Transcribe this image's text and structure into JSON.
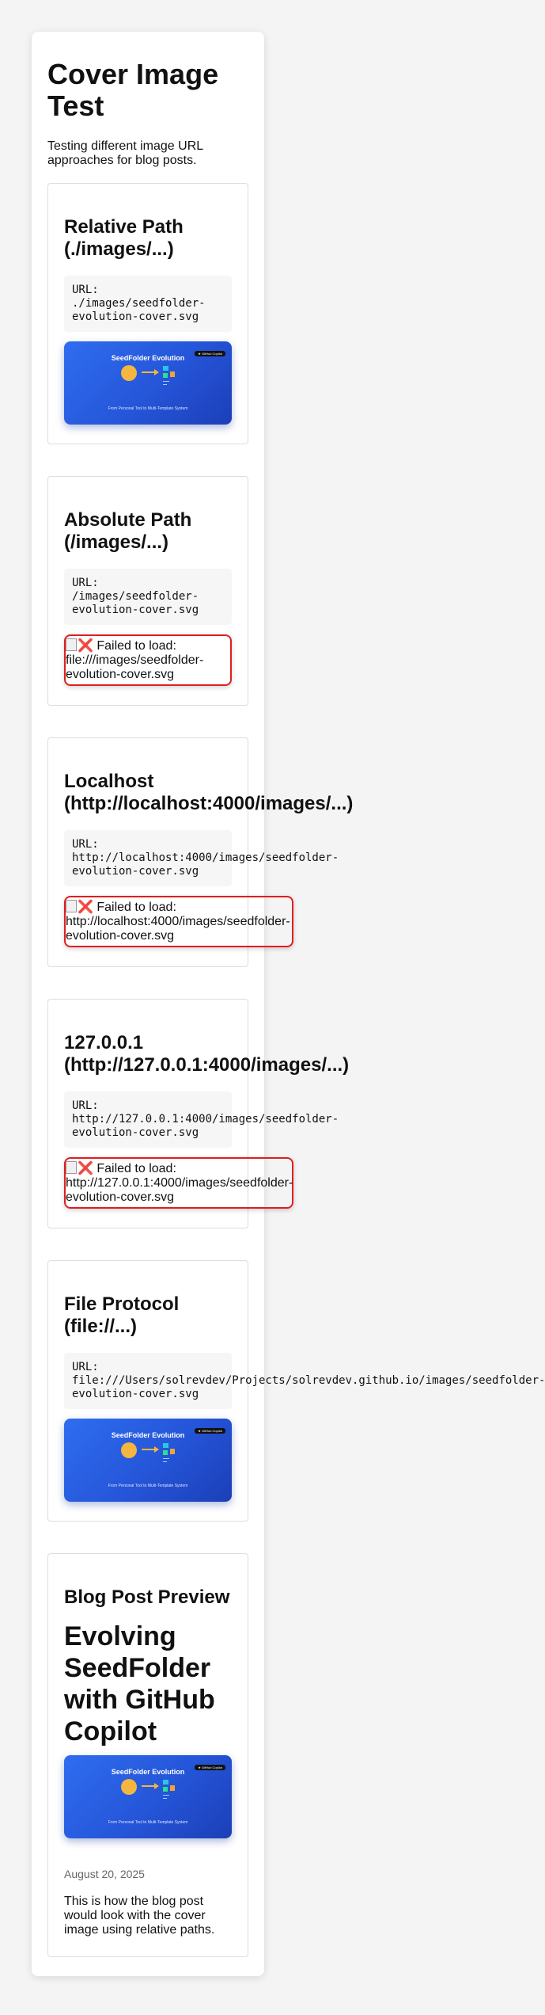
{
  "title": "Cover Image Test",
  "intro": [
    "Testing different image URL",
    "approaches for blog posts."
  ],
  "url_prefix": "URL:",
  "cover": {
    "title": "SeedFolder Evolution",
    "badge": "★ GitHub Copilot",
    "subtitle": "From Personal Tool to Multi-Template System",
    "accent": "#2555d8"
  },
  "error_prefix": "Failed to load:",
  "error_icon": "❌",
  "tests": [
    {
      "heading": [
        "Relative Path",
        "(./images/...)"
      ],
      "url_lines": [
        "./images/seedfolder-",
        "evolution-cover.svg"
      ],
      "status": "loaded"
    },
    {
      "heading": [
        "Absolute Path",
        "(/images/...)"
      ],
      "url_lines": [
        "/images/seedfolder-",
        "evolution-cover.svg"
      ],
      "status": "failed",
      "error_lines": [
        "file:///images/seedfolder-",
        "evolution-cover.svg"
      ]
    },
    {
      "heading": [
        "Localhost",
        "(http://localhost:4000/images/...)"
      ],
      "url_lines": [
        "http://localhost:4000/images/seedfolder-",
        "evolution-cover.svg"
      ],
      "status": "failed",
      "error_lines": [
        "http://localhost:4000/images/seedfolder-",
        "evolution-cover.svg"
      ]
    },
    {
      "heading": [
        "127.0.0.1",
        "(http://127.0.0.1:4000/images/...)"
      ],
      "url_lines": [
        "http://127.0.0.1:4000/images/seedfolder-",
        "evolution-cover.svg"
      ],
      "status": "failed",
      "error_lines": [
        "http://127.0.0.1:4000/images/seedfolder-",
        "evolution-cover.svg"
      ]
    },
    {
      "heading": [
        "File Protocol",
        "(file://...)"
      ],
      "url_lines": [
        "file:///Users/solrevdev/Projects/solrevdev.github.io/images/seedfolder-",
        "evolution-cover.svg"
      ],
      "status": "loaded"
    }
  ],
  "preview": {
    "heading": "Blog Post Preview",
    "post_title": [
      "Evolving",
      "SeedFolder",
      "with GitHub",
      "Copilot"
    ],
    "date": "August 20, 2025",
    "description": [
      "This is how the blog post",
      "would look with the cover",
      "image using relative paths."
    ]
  }
}
